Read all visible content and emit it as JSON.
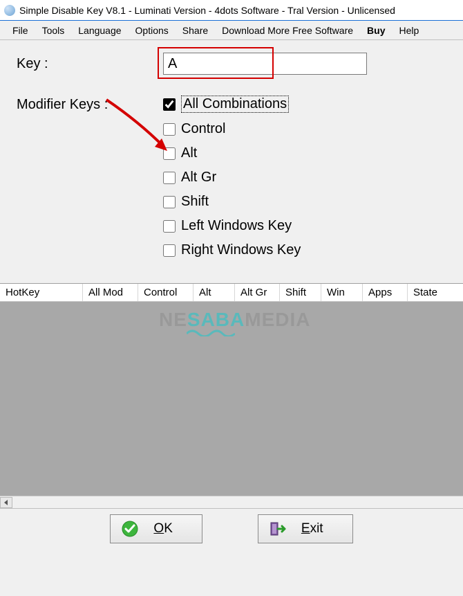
{
  "titlebar": {
    "title": "Simple Disable Key V8.1 - Luminati Version - 4dots Software - Tral Version - Unlicensed"
  },
  "menubar": {
    "items": [
      {
        "label": "File",
        "bold": false
      },
      {
        "label": "Tools",
        "bold": false
      },
      {
        "label": "Language",
        "bold": false
      },
      {
        "label": "Options",
        "bold": false
      },
      {
        "label": "Share",
        "bold": false
      },
      {
        "label": "Download More Free Software",
        "bold": false
      },
      {
        "label": "Buy",
        "bold": true
      },
      {
        "label": "Help",
        "bold": false
      }
    ]
  },
  "form": {
    "key_label": "Key :",
    "key_value": "A",
    "mod_label": "Modifier Keys :",
    "modifiers": [
      {
        "label": "All Combinations",
        "checked": true,
        "focused": true
      },
      {
        "label": "Control",
        "checked": false,
        "focused": false
      },
      {
        "label": "Alt",
        "checked": false,
        "focused": false
      },
      {
        "label": "Alt Gr",
        "checked": false,
        "focused": false
      },
      {
        "label": "Shift",
        "checked": false,
        "focused": false
      },
      {
        "label": "Left Windows Key",
        "checked": false,
        "focused": false
      },
      {
        "label": "Right Windows Key",
        "checked": false,
        "focused": false
      }
    ]
  },
  "watermark": {
    "part1": "NE",
    "part2": "SABA",
    "part3": "MEDIA"
  },
  "table": {
    "columns": [
      "HotKey",
      "All Mod",
      "Control",
      "Alt",
      "Alt Gr",
      "Shift",
      "Win",
      "Apps",
      "State"
    ]
  },
  "buttons": {
    "ok": "OK",
    "exit": "Exit"
  }
}
